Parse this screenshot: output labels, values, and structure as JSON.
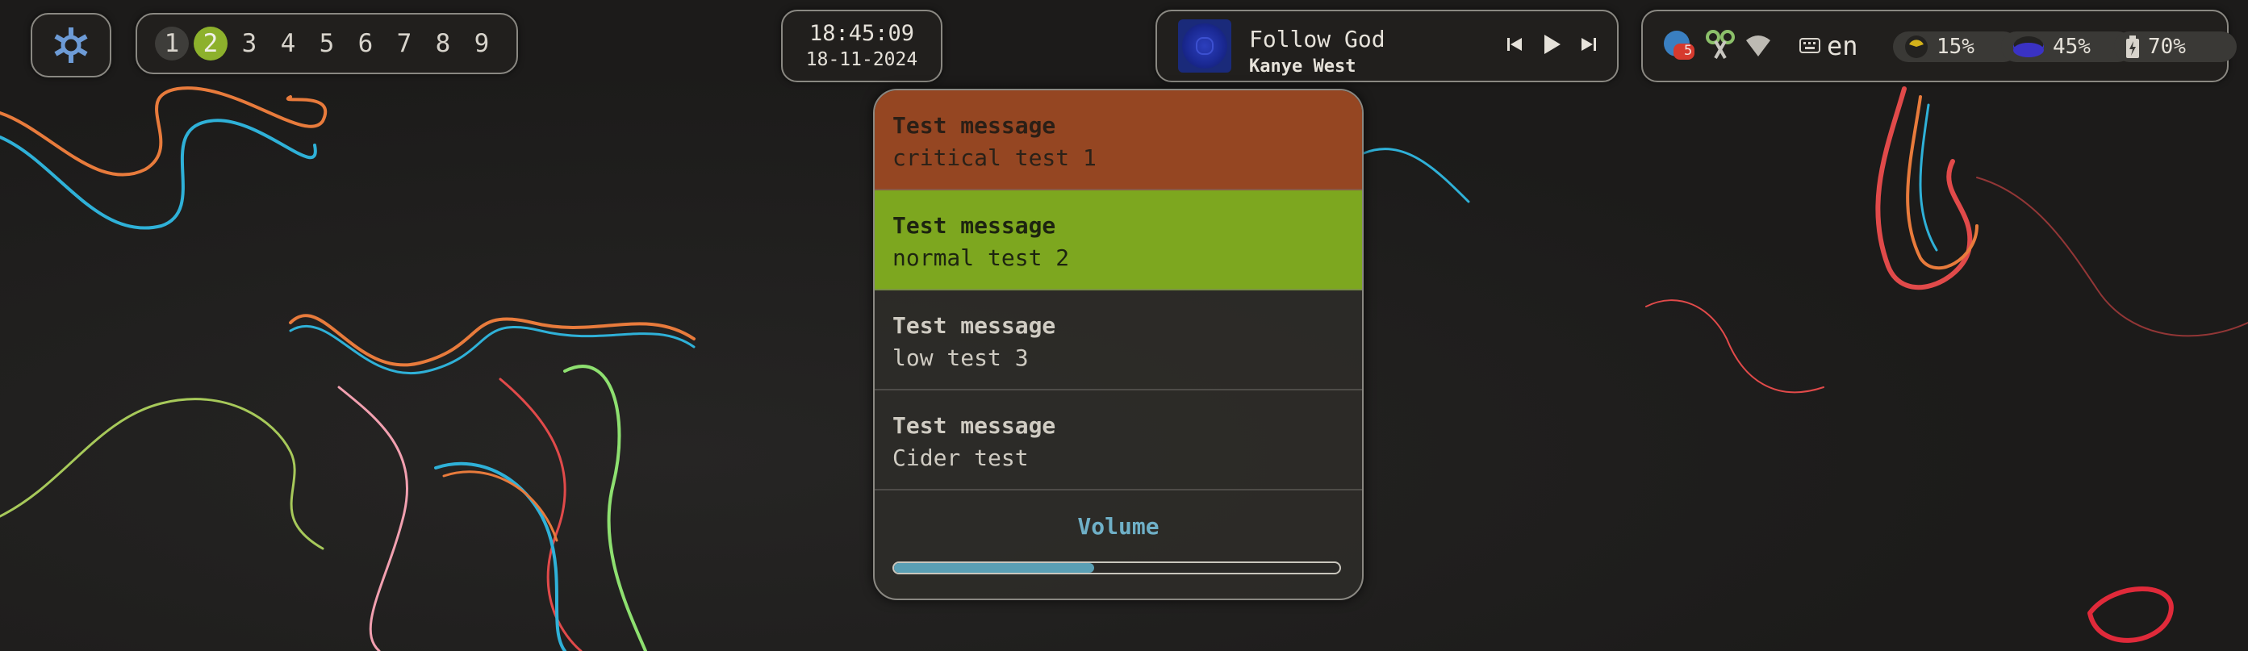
{
  "workspaces": {
    "items": [
      "1",
      "2",
      "3",
      "4",
      "5",
      "6",
      "7",
      "8",
      "9"
    ],
    "active": "2",
    "occupied": [
      "1",
      "2"
    ]
  },
  "clock": {
    "time": "18:45:09",
    "date": "18-11-2024"
  },
  "media": {
    "title": "Follow God",
    "artist": "Kanye West",
    "cover_icon": "album-cover"
  },
  "tray": {
    "badge_count": "5",
    "layout": "en",
    "cpu_percent": "15%",
    "memory_percent": "45%",
    "battery_percent": "70%",
    "icons": [
      "app-indicator-icon",
      "scissors-icon",
      "wifi-icon",
      "keyboard-icon",
      "cpu-pie-icon",
      "memory-pie-icon",
      "battery-icon"
    ]
  },
  "notifications": [
    {
      "urgency": "critical",
      "summary": "Test message",
      "body": "critical test 1"
    },
    {
      "urgency": "normal",
      "summary": "Test message",
      "body": "normal test 2"
    },
    {
      "urgency": "low",
      "summary": "Test message",
      "body": "low test 3"
    },
    {
      "urgency": "low",
      "summary": "Test message",
      "body": "Cider test"
    }
  ],
  "volume": {
    "label": "Volume",
    "level": 0.45
  },
  "colors": {
    "critical": "#a44a22",
    "normal": "#84b21e",
    "accent_volume": "#5a9fb4",
    "workspace_active": "#8db12c"
  }
}
